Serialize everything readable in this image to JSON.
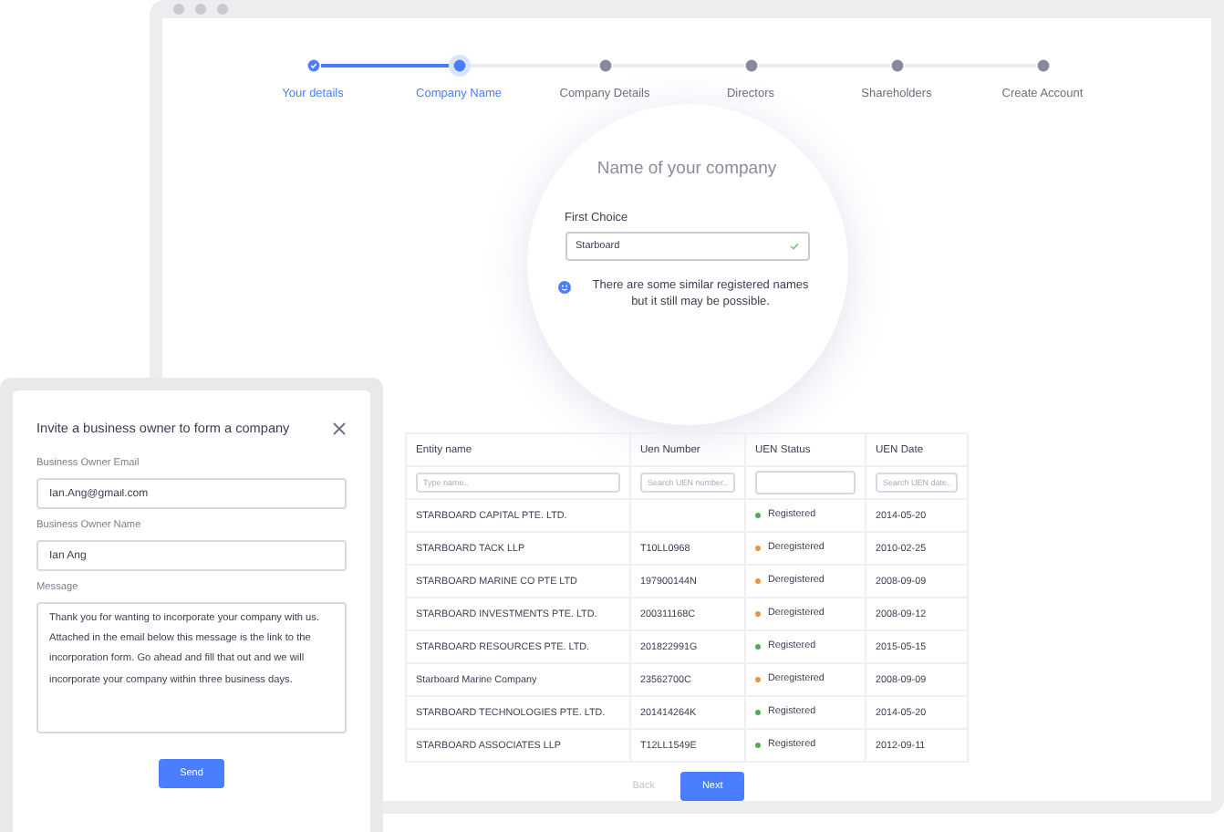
{
  "stepper": [
    {
      "label": "Your details",
      "completed": true,
      "selected": false
    },
    {
      "label": "Company Name",
      "completed": false,
      "selected": true
    },
    {
      "label": "Company Details",
      "completed": false,
      "selected": false
    },
    {
      "label": "Directors",
      "completed": false,
      "selected": false
    },
    {
      "label": "Shareholders",
      "completed": false,
      "selected": false
    },
    {
      "label": "Create Account",
      "completed": false,
      "selected": false
    }
  ],
  "name_card": {
    "title": "Name of your company",
    "field_label": "First Choice",
    "value": "Starboard",
    "valid": true,
    "notice": "There are some similar registered names but it still may be possible."
  },
  "table": {
    "columns": [
      "Entity name",
      "Uen Number",
      "UEN Status",
      "UEN Date"
    ],
    "filters": [
      {
        "kind": "input",
        "placeholder": "Type name.."
      },
      {
        "kind": "input",
        "placeholder": "Search UEN number.."
      },
      {
        "kind": "select"
      },
      {
        "kind": "input",
        "placeholder": "Search UEN date.."
      }
    ],
    "rows": [
      {
        "entity": "STARBOARD CAPITAL PTE. LTD.",
        "status": "Registered",
        "color": "#4caf50",
        "date": "2014-05-20"
      },
      {
        "entity": "STARBOARD TACK LLP",
        "uen": "T10LL0968",
        "status": "Deregistered",
        "color": "#f5923e",
        "date": "2010-02-25"
      },
      {
        "entity": "STARBOARD MARINE CO PTE LTD",
        "uen": "197900144N",
        "status": "Deregistered",
        "color": "#f5923e",
        "date": "2008-09-09"
      },
      {
        "entity": "STARBOARD INVESTMENTS PTE. LTD.",
        "uen": "200311168C",
        "status": "Deregistered",
        "color": "#f5923e",
        "date": "2008-09-12"
      },
      {
        "entity": "STARBOARD RESOURCES PTE. LTD.",
        "uen": "201822991G",
        "status": "Registered",
        "color": "#4caf50",
        "date": "2015-05-15"
      },
      {
        "entity": "Starboard Marine Company",
        "uen": "23562700C",
        "status": "Deregistered",
        "color": "#f5923e",
        "date": "2008-09-09"
      },
      {
        "entity": "STARBOARD TECHNOLOGIES PTE. LTD.",
        "uen": "201414264K",
        "status": "Registered",
        "color": "#4caf50",
        "date": "2014-05-20"
      },
      {
        "entity": "STARBOARD ASSOCIATES LLP",
        "uen": "T12LL1549E",
        "status": "Registered",
        "color": "#4caf50",
        "date": "2012-09-11"
      }
    ]
  },
  "actions": [
    {
      "label": "Back",
      "disabled": true
    },
    {
      "label": "Next",
      "disabled": false
    }
  ],
  "invite": {
    "title": "Invite a business owner to form a company",
    "fields": [
      {
        "kind": "input",
        "label": "Business Owner Email",
        "value": "Ian.Ang@gmail.com"
      },
      {
        "kind": "input",
        "label": "Business Owner Name",
        "value": "Ian Ang"
      },
      {
        "kind": "textarea",
        "label": "Message",
        "value": "Thank you for wanting to incorporate your company with us. Attached in the email below this message is the link to the incorporation form. Go ahead and fill that out and we will incorporate your company within three business days."
      }
    ],
    "button": "Send"
  }
}
